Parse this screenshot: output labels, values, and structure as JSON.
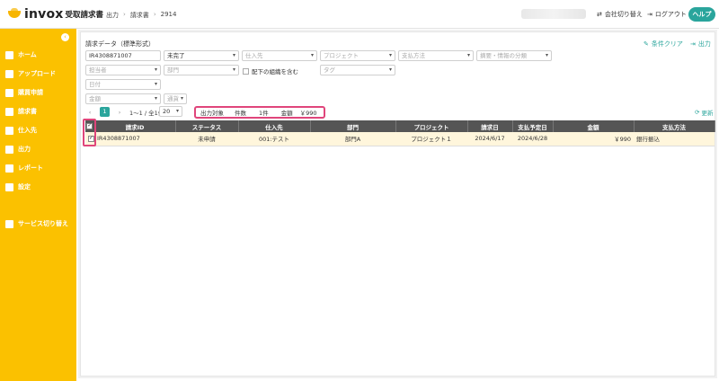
{
  "app": {
    "name": "invox",
    "subtitle": "受取請求書"
  },
  "breadcrumb": [
    "出力",
    "請求書",
    "2914"
  ],
  "topbar": {
    "switch_company": "会社切り替え",
    "logout": "ログアウト",
    "help": "ヘルプ"
  },
  "sidebar": {
    "items": [
      {
        "label": "ホーム",
        "icon": "home-icon"
      },
      {
        "label": "アップロード",
        "icon": "upload-icon"
      },
      {
        "label": "購買申請",
        "icon": "purchase-icon"
      },
      {
        "label": "請求書",
        "icon": "invoice-icon"
      },
      {
        "label": "仕入先",
        "icon": "supplier-icon"
      },
      {
        "label": "出力",
        "icon": "export-icon"
      },
      {
        "label": "レポート",
        "icon": "report-icon"
      },
      {
        "label": "設定",
        "icon": "gear-icon"
      },
      {
        "label": "サービス切り替え",
        "icon": "switch-icon"
      }
    ]
  },
  "main": {
    "title": "請求データ（標準形式）",
    "clear_conditions": "条件クリア",
    "export": "出力",
    "filters": {
      "invoice_id": "IR4308871007",
      "status": "未完了",
      "supplier": "仕入先",
      "project": "プロジェクト",
      "payment_method": "支払方法",
      "account": "摘要・情報の分類",
      "assignee": "担当者",
      "department": "部門",
      "include_sub": "配下の組織を含む",
      "tag": "タグ",
      "date": "日付",
      "amount": "金額",
      "currency": "通貨"
    },
    "pager": {
      "current": "1",
      "range": "1〜1 / 全1件",
      "per_page": "20"
    },
    "summary": {
      "label": "出力対象",
      "count_label": "件数",
      "count": "1件",
      "amount_label": "金額",
      "amount": "￥990"
    },
    "refresh": "更新",
    "table": {
      "headers": [
        "請求ID",
        "ステータス",
        "仕入先",
        "部門",
        "プロジェクト",
        "請求日",
        "支払予定日",
        "金額",
        "支払方法"
      ],
      "rows": [
        {
          "id": "IR4308871007",
          "status": "未申請",
          "supplier": "001:テスト",
          "department": "部門A",
          "project": "プロジェクト１",
          "invoice_date": "2024/6/17",
          "due_date": "2024/6/28",
          "amount": "￥990",
          "payment": "銀行振込"
        }
      ]
    }
  }
}
